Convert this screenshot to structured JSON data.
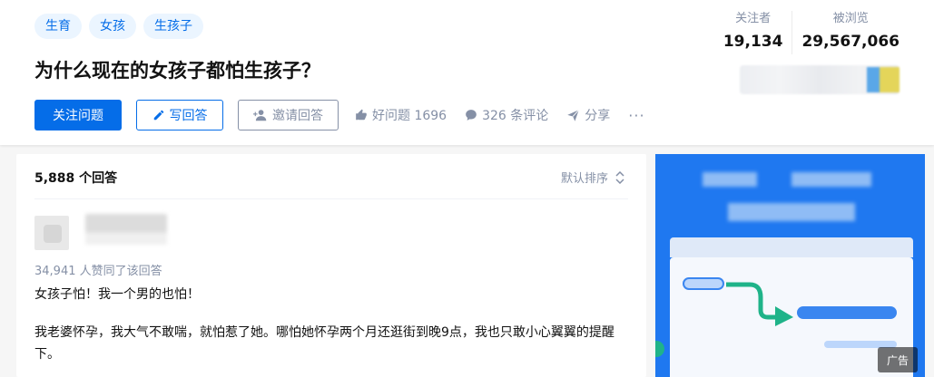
{
  "question": {
    "topics": [
      "生育",
      "女孩",
      "生孩子"
    ],
    "title": "为什么现在的女孩子都怕生孩子？",
    "followers_label": "关注者",
    "followers": "19,134",
    "views_label": "被浏览",
    "views": "29,567,066"
  },
  "actions": {
    "follow": "关注问题",
    "write": "写回答",
    "invite": "邀请回答",
    "good_question": "好问题 1696",
    "comments": "326 条评论",
    "share": "分享",
    "more": "···"
  },
  "answers": {
    "count": "5,888 个回答",
    "sort": "默认排序",
    "first": {
      "votes": "34,941 人赞同了该回答",
      "p1": "女孩子怕！我一个男的也怕！",
      "p2": "我老婆怀孕，我大气不敢喘，就怕惹了她。哪怕她怀孕两个月还逛街到晚9点，我也只敢小心翼翼的提醒下。"
    }
  },
  "ad": {
    "badge": "广告"
  },
  "colors": {
    "brand_blue": "#056de8",
    "muted_gray": "#8590a6",
    "topic_bg": "#ebf5ff",
    "ad_bg": "#1f78f0",
    "ad_arrow": "#1fb389"
  }
}
